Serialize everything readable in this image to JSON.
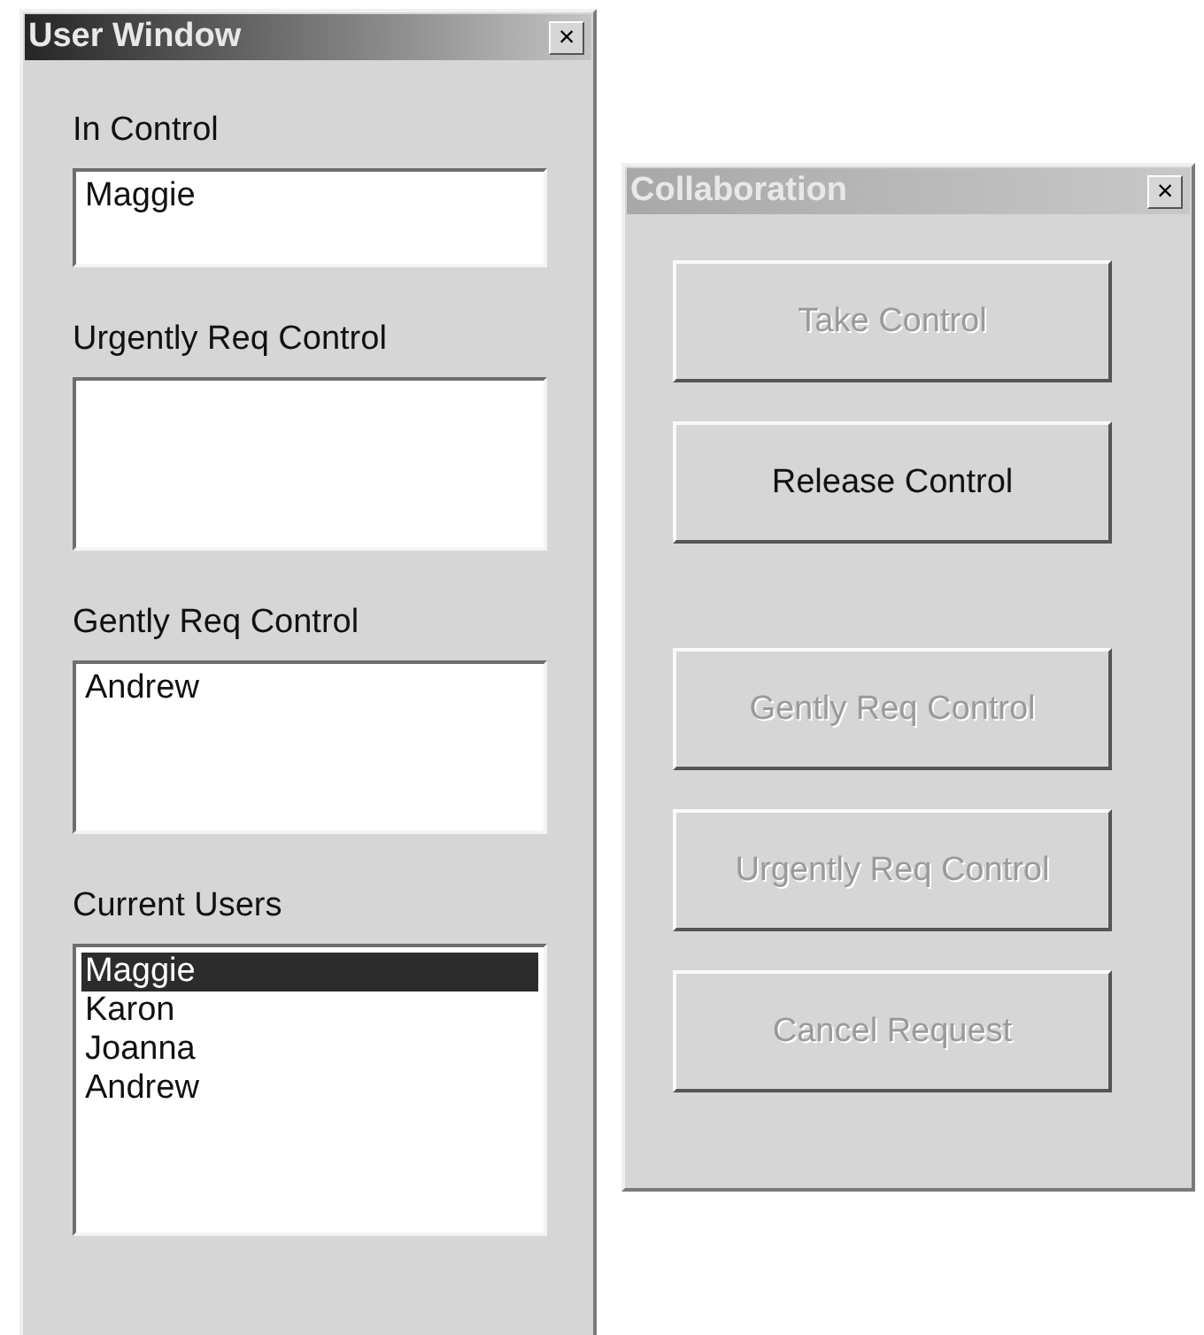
{
  "user_window": {
    "title": "User Window",
    "active": true,
    "close": "×",
    "boxes": [
      {
        "label": "In Control",
        "kind": "textbox",
        "items": [
          {
            "text": "Maggie",
            "selected": false
          }
        ]
      },
      {
        "label": "Urgently Req Control",
        "kind": "listbox"
      },
      {
        "label": "Gently Req Control",
        "kind": "listbox",
        "items": [
          {
            "text": "Andrew",
            "selected": false
          }
        ]
      },
      {
        "label": "Current Users",
        "kind": "userlist",
        "items": [
          {
            "text": "Maggie",
            "selected": true
          },
          {
            "text": "Karon",
            "selected": false
          },
          {
            "text": "Joanna",
            "selected": false
          },
          {
            "text": "Andrew",
            "selected": false
          }
        ]
      }
    ]
  },
  "collaboration_window": {
    "title": "Collaboration",
    "active": false,
    "close": "×",
    "button_groups": [
      [
        {
          "label": "Take Control",
          "disabled": true
        },
        {
          "label": "Release Control",
          "disabled": false
        }
      ],
      [
        {
          "label": "Gently Req Control",
          "disabled": true
        },
        {
          "label": "Urgently Req Control",
          "disabled": true
        },
        {
          "label": "Cancel Request",
          "disabled": true
        }
      ]
    ]
  }
}
